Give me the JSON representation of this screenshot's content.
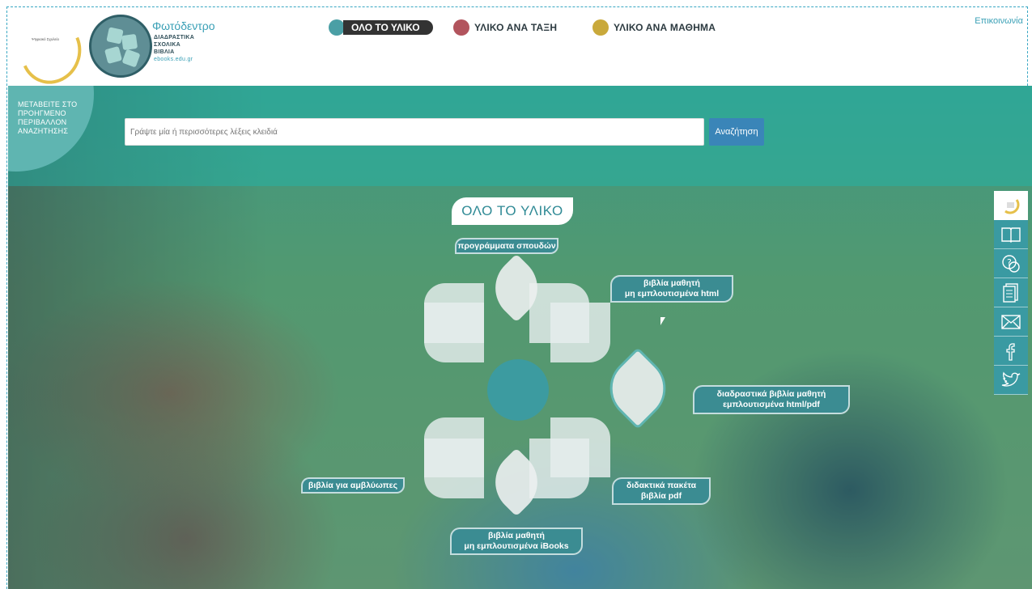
{
  "header": {
    "logo_text": "Ψηφιακό Σχολείο",
    "brand_name": "Φωτόδεντρο",
    "brand_lines": [
      "ΔΙΑΔΡΑΣΤΙΚΑ",
      "ΣΧΟΛΙΚΑ",
      "ΒΙΒΛΙΑ"
    ],
    "brand_url": "ebooks.edu.gr",
    "nav": [
      {
        "label": "ΟΛΟ ΤΟ ΥΛΙΚΟ",
        "color": "#4a9fa5",
        "active": true
      },
      {
        "label": "ΥΛΙΚΟ ΑΝΑ ΤΑΞΗ",
        "color": "#b2545d",
        "active": false
      },
      {
        "label": "ΥΛΙΚΟ ΑΝΑ ΜΑΘΗΜΑ",
        "color": "#c9a93b",
        "active": false
      }
    ],
    "contact": "Επικοινωνία"
  },
  "search": {
    "back_text": "ΜΕΤΑΒΕΙΤΕ ΣΤΟ ΠΡΟΗΓΜΕΝΟ ΠΕΡΙΒΑΛΛΟΝ ΑΝΑΖΗΤΗΣΗΣ",
    "placeholder": "Γράψτε μία ή περισσότερες λέξεις κλειδιά",
    "button_label": "Αναζήτηση"
  },
  "main": {
    "title": "ΟΛΟ ΤΟ ΥΛΙΚΟ",
    "labels": {
      "curricula": "προγράμματα σπουδών",
      "student_books_plain_1": "βιβλία μαθητή",
      "student_books_plain_2": "μη εμπλουτισμένα html",
      "interactive_1": "διαδραστικά βιβλία μαθητή",
      "interactive_2": "εμπλουτισμένα html/pdf",
      "teaching_1": "διδακτικά πακέτα",
      "teaching_2": "βιβλία pdf",
      "ibooks_1": "βιβλία μαθητή",
      "ibooks_2": "μη εμπλουτισμένα iBooks",
      "low_vision": "βιβλία για αμβλύωπες"
    }
  },
  "sidebar": {
    "icons": [
      "logo-icon",
      "book-icon",
      "help-icon",
      "document-icon",
      "mail-icon",
      "facebook-icon",
      "twitter-icon"
    ]
  },
  "colors": {
    "accent": "#3aa0b6",
    "teal": "#3b8c92",
    "search_button": "#3a85b8"
  }
}
